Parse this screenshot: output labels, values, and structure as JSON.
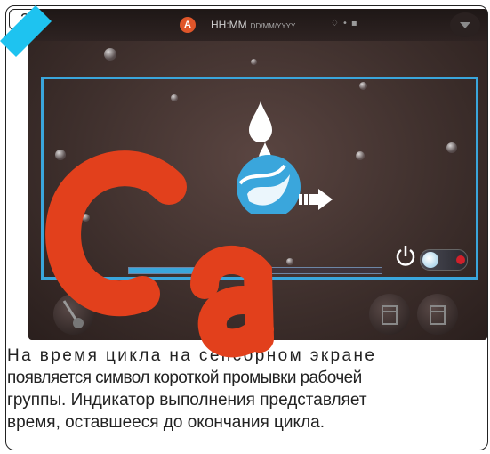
{
  "step_number": "3",
  "status_bar": {
    "warning_badge": "A",
    "time": "HH:MM",
    "date": "DD/MM/YYYY"
  },
  "progress": {
    "fraction": 0.33
  },
  "power_toggle": {
    "state": "on"
  },
  "icons": {
    "rinse": "rinse-cycle-icon",
    "power": "power-icon",
    "steam_wand": "steam-wand-icon",
    "cup": "cup-icon",
    "menu": "chevron-down-icon"
  },
  "colors": {
    "accent": "#3aa6dc",
    "toggle_indicator": "#d0202a",
    "watermark": "#e2401c"
  },
  "caption": {
    "line1": "На время цикла на сенсорном экране",
    "line2": "появляется символ короткой промывки рабочей",
    "line3": "группы. Индикатор выполнения представляет",
    "line4": "время, оставшееся до окончания цикла."
  }
}
